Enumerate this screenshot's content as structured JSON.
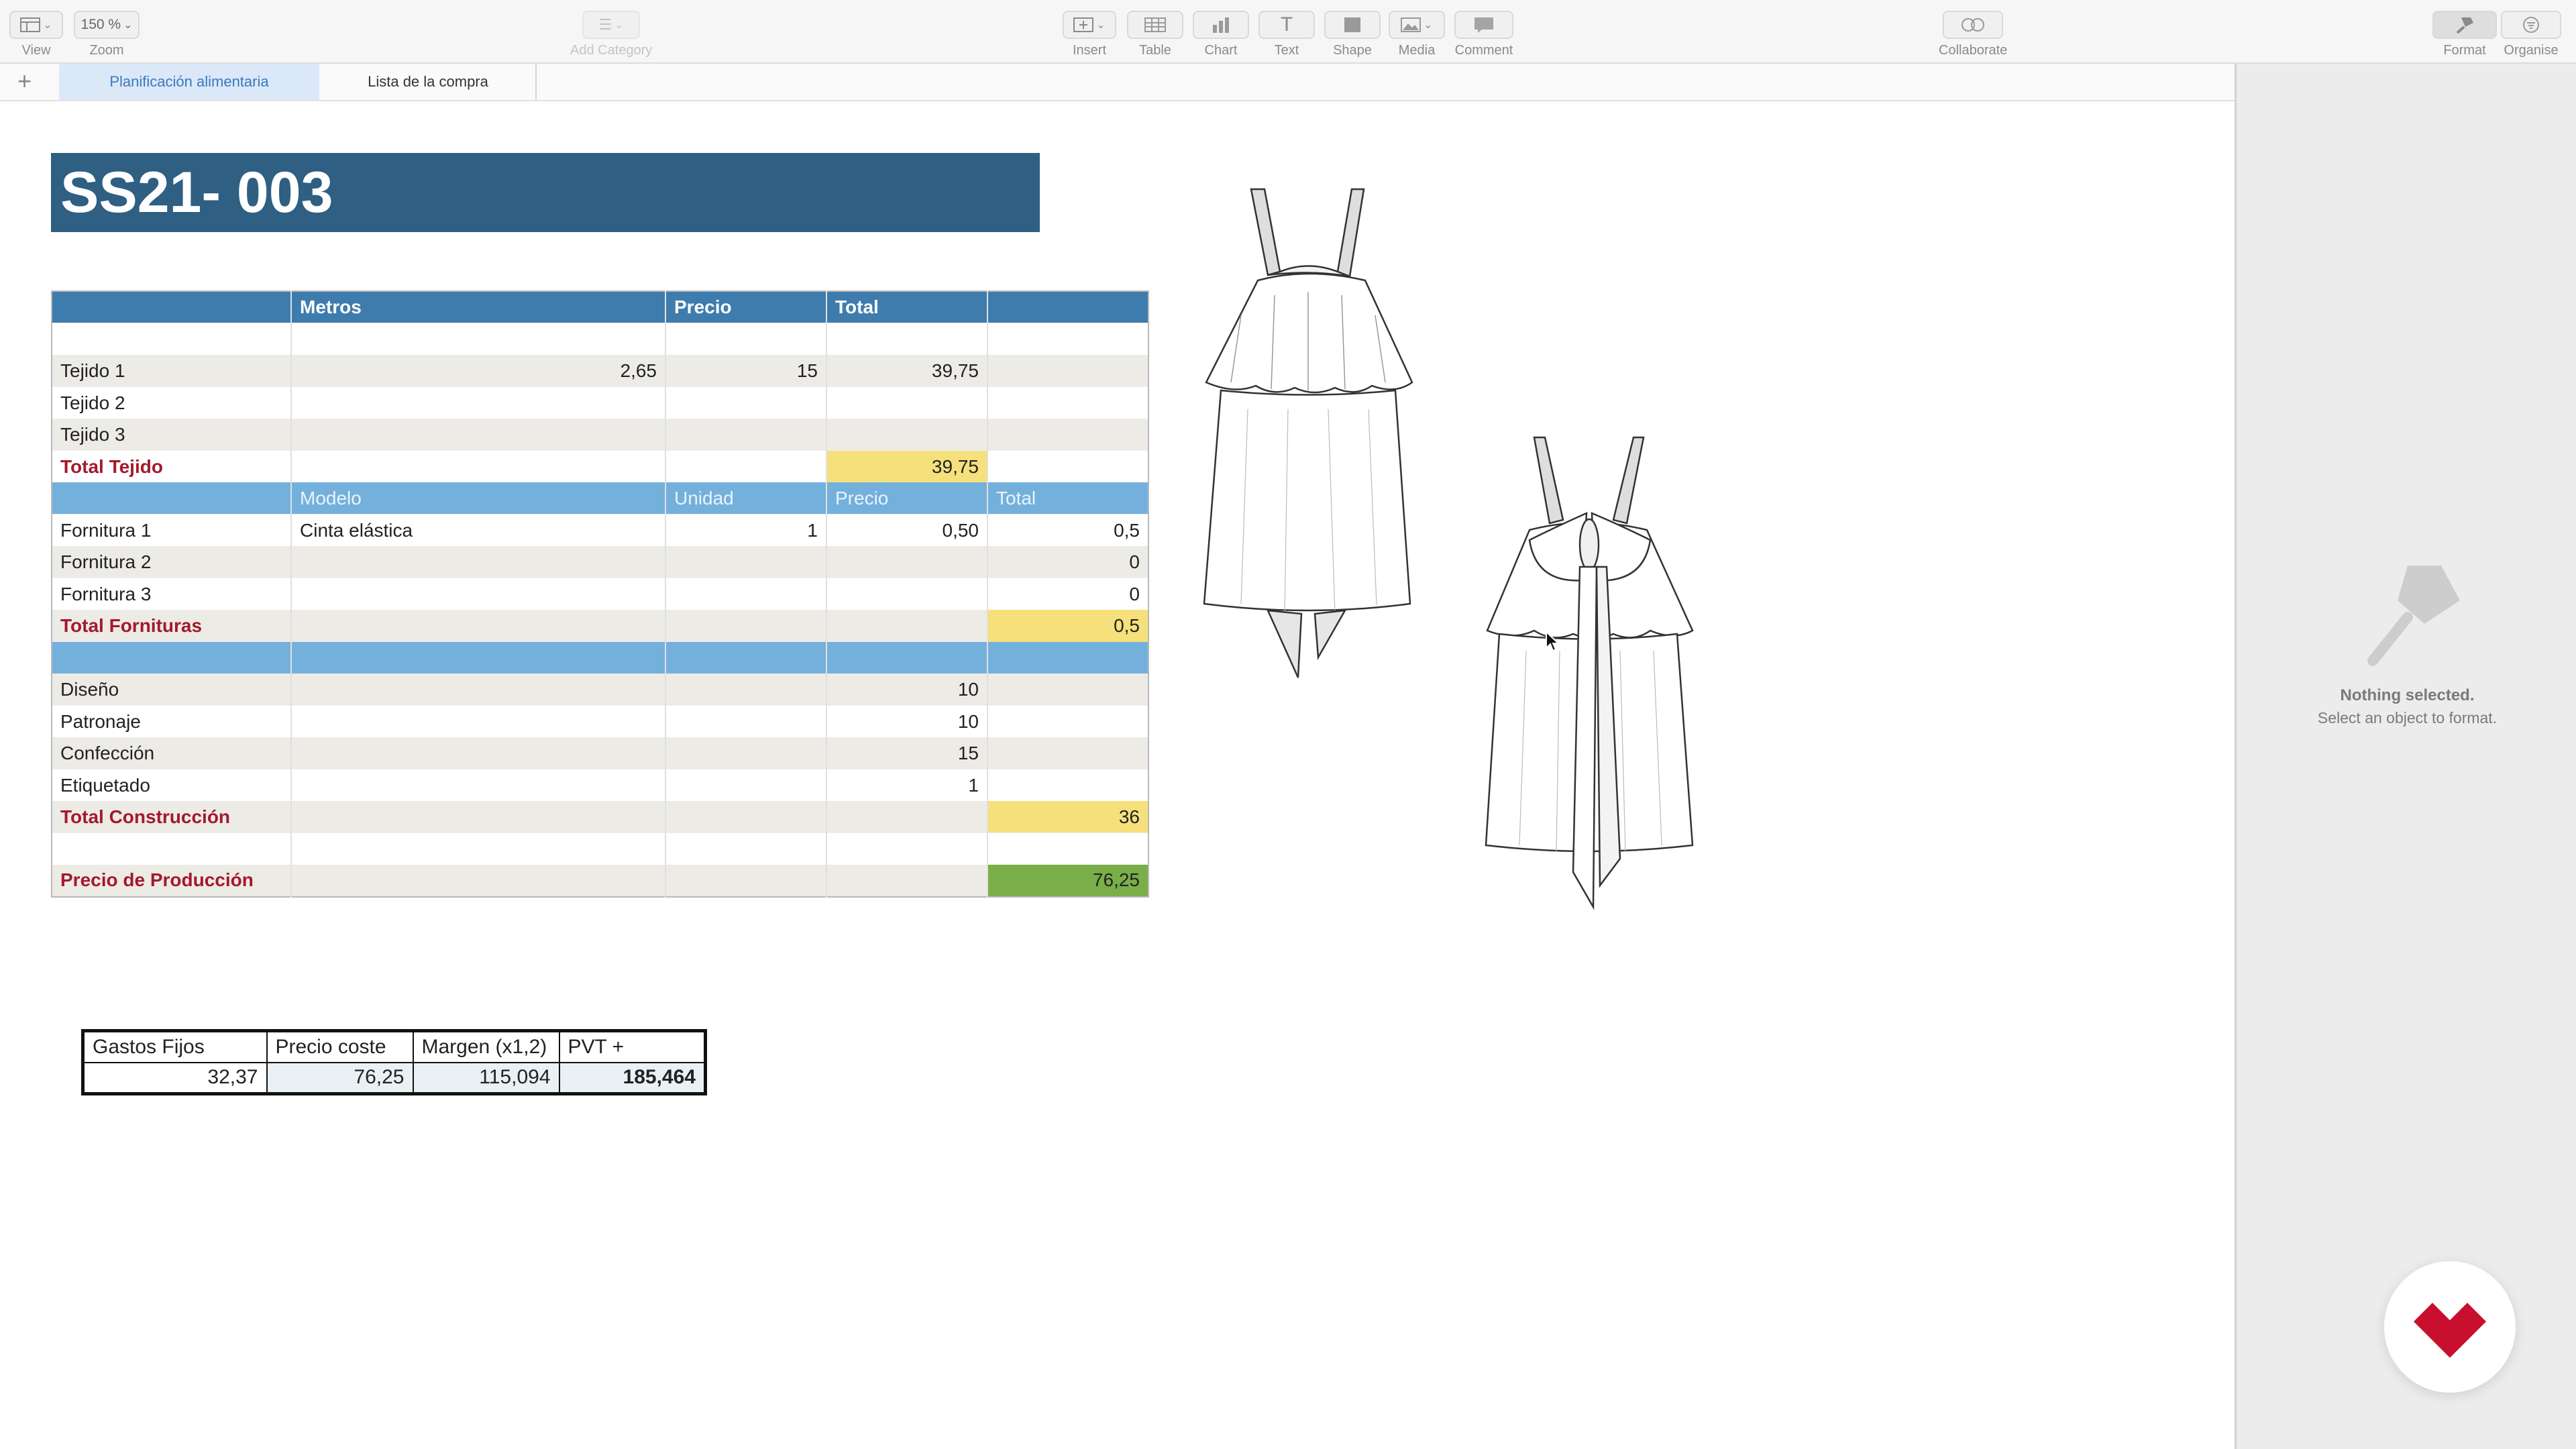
{
  "toolbar": {
    "view": "View",
    "zoom_value": "150 %",
    "zoom": "Zoom",
    "add_category": "Add Category",
    "insert": "Insert",
    "table": "Table",
    "chart": "Chart",
    "text": "Text",
    "shape": "Shape",
    "media": "Media",
    "comment": "Comment",
    "collaborate": "Collaborate",
    "format": "Format",
    "organise": "Organise"
  },
  "tabs": {
    "add": "+",
    "items": [
      {
        "label": "Planificación alimentaria",
        "active": true
      },
      {
        "label": "Lista de la compra",
        "active": false
      }
    ]
  },
  "sheet": {
    "title": "SS21- 003"
  },
  "cost_table": {
    "header": [
      "",
      "Metros",
      "Precio",
      "Total",
      "",
      ""
    ],
    "rows": [
      [
        "",
        "",
        "",
        "",
        "",
        ""
      ],
      [
        "Tejido 1",
        "",
        "2,65",
        "15",
        "39,75",
        ""
      ],
      [
        "Tejido 2",
        "",
        "",
        "",
        "",
        ""
      ],
      [
        "Tejido 3",
        "",
        "",
        "",
        "",
        ""
      ],
      [
        "Total Tejido",
        "",
        "",
        "",
        "39,75",
        ""
      ],
      [
        "",
        "Modelo",
        "Unidad",
        "Precio",
        "Total",
        ""
      ],
      [
        "Fornitura 1",
        "Cinta elástica",
        "1",
        "0,50",
        "0,5",
        ""
      ],
      [
        "Fornitura 2",
        "",
        "",
        "",
        "0",
        ""
      ],
      [
        "Fornitura 3",
        "",
        "",
        "",
        "0",
        ""
      ],
      [
        "Total Fornituras",
        "",
        "",
        "",
        "0,5",
        ""
      ],
      [
        "",
        "",
        "",
        "",
        "",
        ""
      ],
      [
        "Diseño",
        "",
        "",
        "10",
        "",
        ""
      ],
      [
        "Patronaje",
        "",
        "",
        "10",
        "",
        ""
      ],
      [
        "Confección",
        "",
        "",
        "15",
        "",
        ""
      ],
      [
        "Etiquetado",
        "",
        "",
        "1",
        "",
        ""
      ],
      [
        "Total Construcción",
        "",
        "",
        "",
        "36",
        ""
      ],
      [
        "",
        "",
        "",
        "",
        "",
        ""
      ],
      [
        "Precio de Producción",
        "",
        "",
        "",
        "76,25",
        ""
      ]
    ]
  },
  "summary_table": {
    "headers": [
      "Gastos Fijos",
      "Precio coste",
      "Margen (x1,2)",
      "PVT +"
    ],
    "values": [
      "32,37",
      "76,25",
      "115,094",
      "185,464"
    ]
  },
  "format_panel": {
    "title": "Nothing selected.",
    "subtitle": "Select an object to format."
  },
  "colors": {
    "title_banner": "#2f5f82",
    "table_header": "#3f7cae",
    "section_band": "#74b0dc",
    "total_text": "#a31a2c",
    "highlight_yellow": "#f5e07b",
    "highlight_green": "#7aae49",
    "logo_red": "#c8102e"
  }
}
